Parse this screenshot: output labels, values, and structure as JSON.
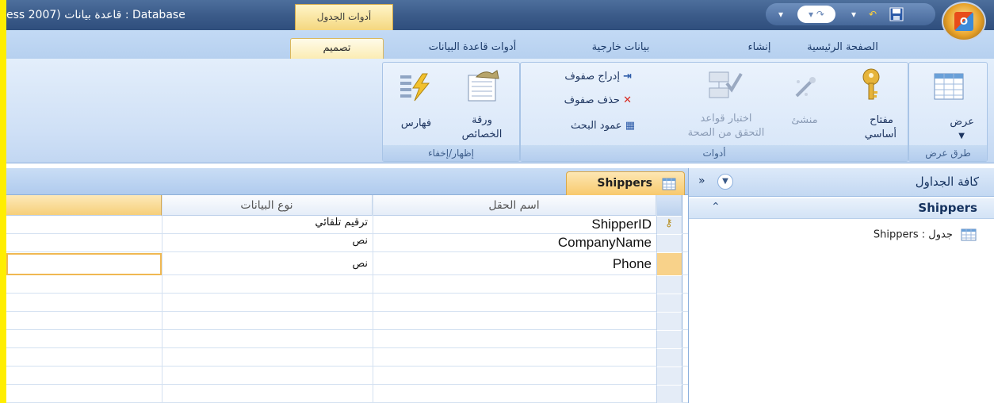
{
  "window": {
    "title": "ess 2007) قاعدة بيانات : Database",
    "context_tab_label": "أدوات الجدول"
  },
  "ribbon_tabs": [
    {
      "label": "الصفحة الرئيسية"
    },
    {
      "label": "إنشاء"
    },
    {
      "label": "بيانات خارجية"
    },
    {
      "label": "أدوات قاعدة البيانات"
    },
    {
      "label": "تصميم"
    }
  ],
  "ribbon": {
    "views_group": {
      "label": "طرق عرض",
      "view_button": "عرض"
    },
    "tools_group": {
      "label": "أدوات",
      "primary_key": [
        "مفتاح",
        "أساسي"
      ],
      "builder": "منشئ",
      "test_validation": [
        "اختبار قواعد",
        "التحقق من الصحة"
      ],
      "insert_rows": "إدراج صفوف",
      "delete_rows": "حذف صفوف",
      "lookup_column": "عمود البحث"
    },
    "showhide_group": {
      "label": "إظهار/إخفاء",
      "property_sheet": [
        "ورقة",
        "الخصائص"
      ],
      "indexes": "فهارس"
    }
  },
  "nav_pane": {
    "title": "كافة الجداول",
    "collapse_glyph": "»",
    "group_name": "Shippers",
    "group_chevron": "⌃",
    "item": "Shippers : جدول"
  },
  "document": {
    "tab_label": "Shippers",
    "columns": {
      "field_name": "اسم الحقل",
      "data_type": "نوع البيانات"
    },
    "rows": [
      {
        "field": "ShipperID",
        "type": "ترقيم تلقائي",
        "is_key": true
      },
      {
        "field": "CompanyName",
        "type": "نص",
        "is_key": false
      },
      {
        "field": "Phone",
        "type": "نص",
        "is_key": false
      }
    ]
  },
  "colors": {
    "title_bar": "#3a5a88",
    "context_tab": "#f4d77f",
    "ribbon_bg": "#cfe0f6",
    "active_row": "#fbe3b0"
  },
  "icons": [
    "office-button-icon",
    "save-icon",
    "undo-icon",
    "redo-icon",
    "table-view-icon",
    "key-icon",
    "builder-wand-icon",
    "validation-icon",
    "insert-rows-icon",
    "delete-rows-icon",
    "lookup-icon",
    "property-sheet-icon",
    "indexes-icon",
    "table-icon"
  ]
}
